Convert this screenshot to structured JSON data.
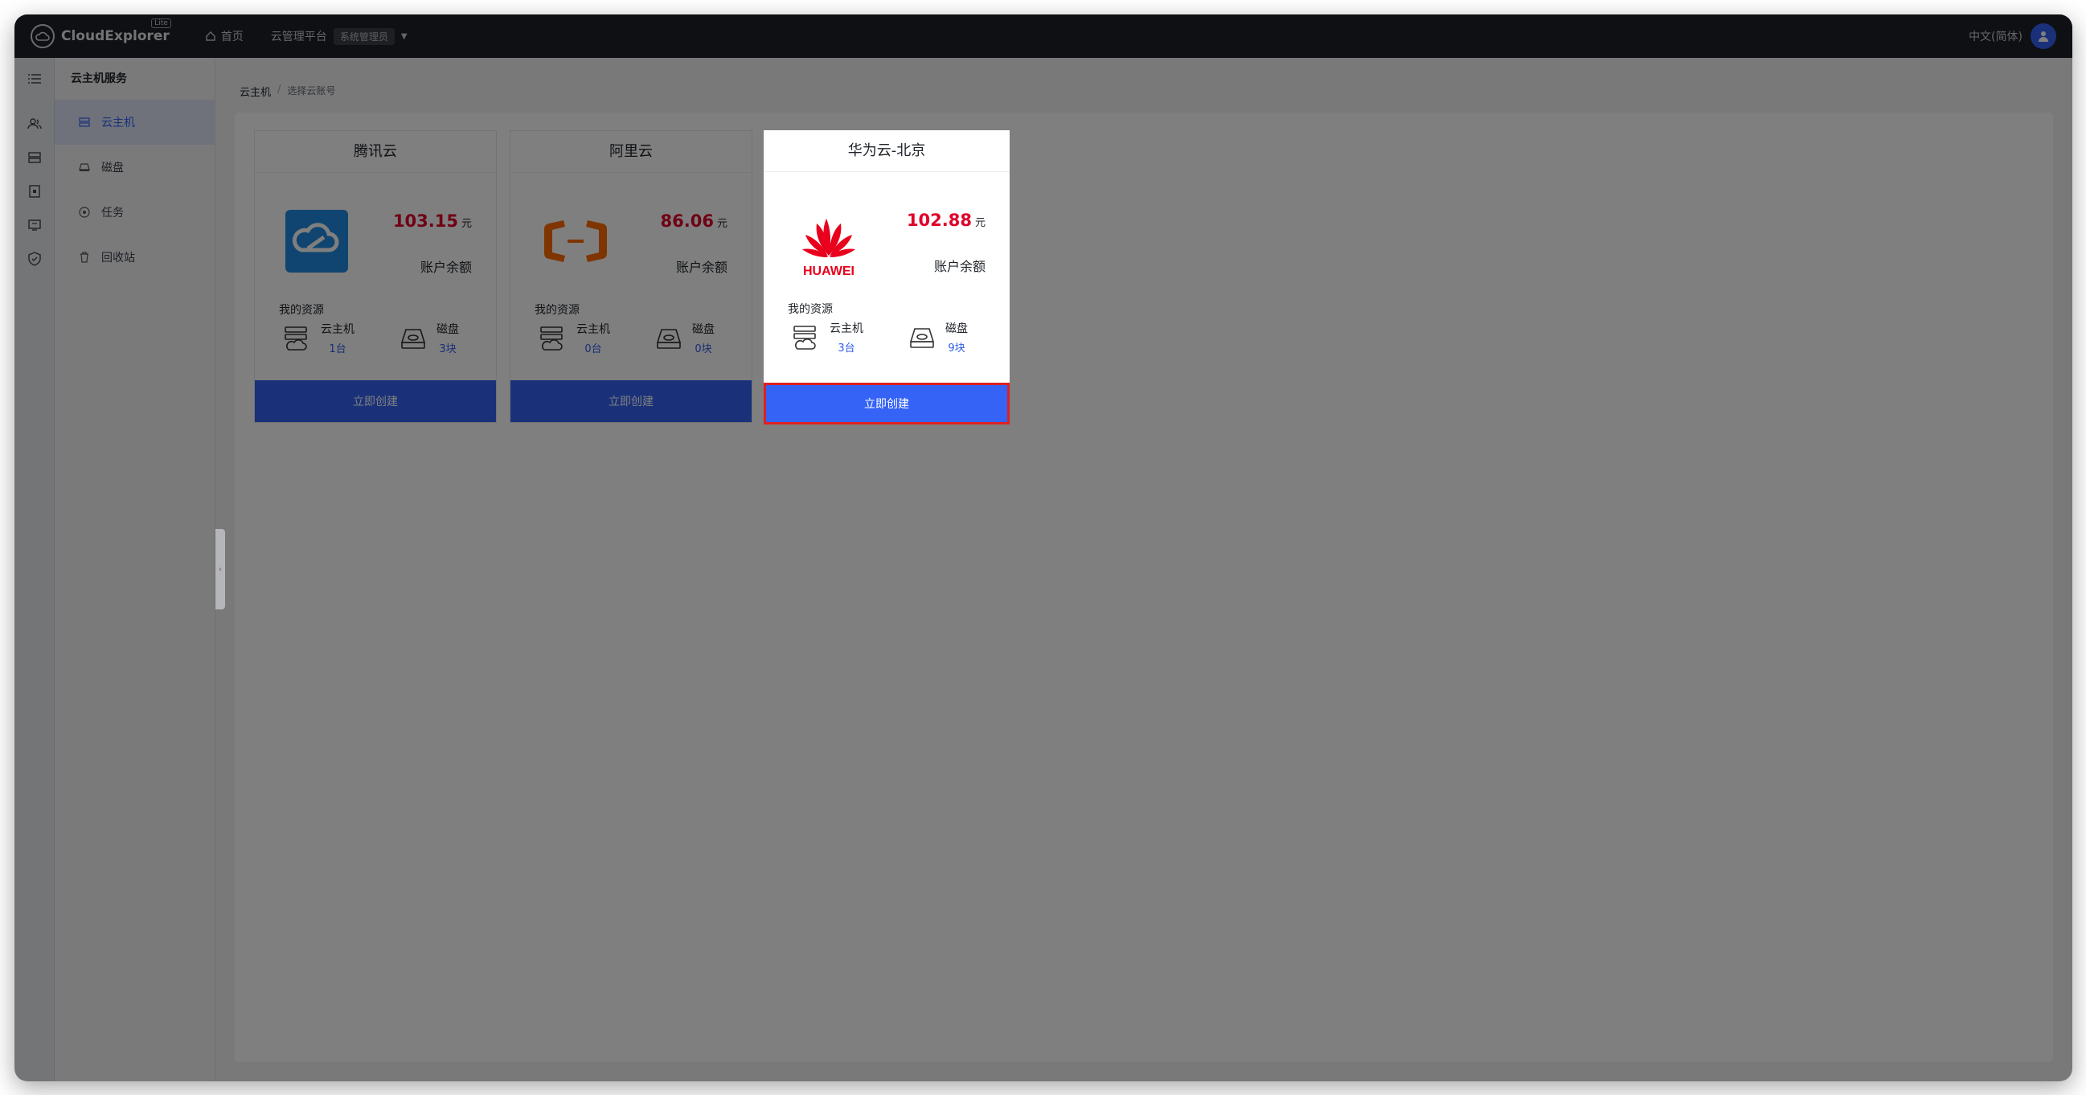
{
  "app": {
    "name": "CloudExplorer",
    "badge": "Lite",
    "home_label": "首页",
    "platform_label": "云管理平台",
    "role_badge": "系统管理员",
    "language": "中文(简体)"
  },
  "subnav": {
    "title": "云主机服务",
    "items": [
      {
        "label": "云主机",
        "icon": "server-icon",
        "active": true
      },
      {
        "label": "磁盘",
        "icon": "disk-icon",
        "active": false
      },
      {
        "label": "任务",
        "icon": "task-icon",
        "active": false
      },
      {
        "label": "回收站",
        "icon": "trash-icon",
        "active": false
      }
    ]
  },
  "breadcrumb": {
    "root": "云主机",
    "current": "选择云账号"
  },
  "cards": [
    {
      "title": "腾讯云",
      "logo": "tencent-cloud-logo",
      "balance": "103.15",
      "unit": "元",
      "balance_label": "账户余额",
      "resources_title": "我的资源",
      "vm_label": "云主机",
      "vm_count": "1台",
      "disk_label": "磁盘",
      "disk_count": "3块",
      "button": "立即创建"
    },
    {
      "title": "阿里云",
      "logo": "aliyun-logo",
      "balance": "86.06",
      "unit": "元",
      "balance_label": "账户余额",
      "resources_title": "我的资源",
      "vm_label": "云主机",
      "vm_count": "0台",
      "disk_label": "磁盘",
      "disk_count": "0块",
      "button": "立即创建"
    },
    {
      "title": "华为云-北京",
      "logo": "huawei-logo",
      "logo_text": "HUAWEI",
      "balance": "102.88",
      "unit": "元",
      "balance_label": "账户余额",
      "resources_title": "我的资源",
      "vm_label": "云主机",
      "vm_count": "3台",
      "disk_label": "磁盘",
      "disk_count": "9块",
      "button": "立即创建"
    }
  ],
  "colors": {
    "accent": "#3463f5",
    "price": "#e0002a",
    "topbar": "#1f2127",
    "highlight": "#e02020"
  }
}
